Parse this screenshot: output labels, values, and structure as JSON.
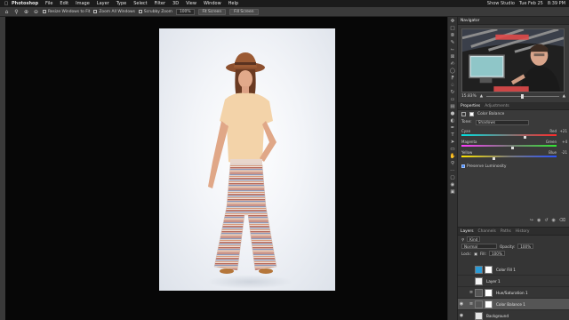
{
  "menubar": {
    "app": "Photoshop",
    "items": [
      "File",
      "Edit",
      "Image",
      "Layer",
      "Type",
      "Select",
      "Filter",
      "3D",
      "View",
      "Window",
      "Help"
    ],
    "status_right": [
      "Show Studio",
      "Tue Feb 25",
      "8:39 PM"
    ]
  },
  "options": {
    "resize_windows": "Resize Windows to Fit",
    "zoom_all": "Zoom All Windows",
    "scrubby_zoom": "Scrubby Zoom",
    "zoom_pct": "100%",
    "fit_screen": "Fit Screen",
    "fill_screen": "Fill Screen"
  },
  "navigator": {
    "tab": "Navigator",
    "zoom": "15.83%"
  },
  "properties": {
    "tabs": [
      "Properties",
      "Adjustments"
    ],
    "adjustment": "Color Balance",
    "tone_label": "Tone:",
    "tone_value": "Shadows",
    "sliders": [
      {
        "left": "Cyan",
        "right": "Red",
        "value": "+21",
        "level": 0.66,
        "gradient": "linear-gradient(90deg,#00e1e1,#7a7a7a,#ff2a2a)"
      },
      {
        "left": "Magenta",
        "right": "Green",
        "value": "+4",
        "level": 0.53,
        "gradient": "linear-gradient(90deg,#ff3cff,#7a7a7a,#32e632)"
      },
      {
        "left": "Yellow",
        "right": "Blue",
        "value": "-21",
        "level": 0.34,
        "gradient": "linear-gradient(90deg,#ffe600,#7a7a7a,#2a52ff)"
      }
    ],
    "preserve_luminosity": "Preserve Luminosity"
  },
  "layers_panel": {
    "tabs": [
      "Layers",
      "Channels",
      "Paths",
      "History"
    ],
    "kind_label": "Kind",
    "blend_mode": "Normal",
    "opacity_label": "Opacity:",
    "opacity": "100%",
    "lock_label": "Lock:",
    "fill_label": "Fill:",
    "fill": "100%",
    "layers": [
      {
        "name": "Color Fill 1",
        "thumb_color": "#2a9bd7",
        "visible": false,
        "selected": false,
        "adjustment": false
      },
      {
        "name": "Layer 1",
        "thumb_color": "#f3f3f3",
        "visible": false,
        "selected": false,
        "adjustment": false
      },
      {
        "name": "Hue/Saturation 1",
        "thumb_color": "#555555",
        "visible": false,
        "selected": false,
        "adjustment": true
      },
      {
        "name": "Color Balance 1",
        "thumb_color": "#555555",
        "visible": true,
        "selected": true,
        "adjustment": true
      },
      {
        "name": "Background",
        "thumb_color": "#e5e5e5",
        "visible": true,
        "selected": false,
        "adjustment": false
      }
    ]
  },
  "colors": {
    "accent_checkbox": "#3a85ff",
    "selected_layer": "#555555"
  }
}
